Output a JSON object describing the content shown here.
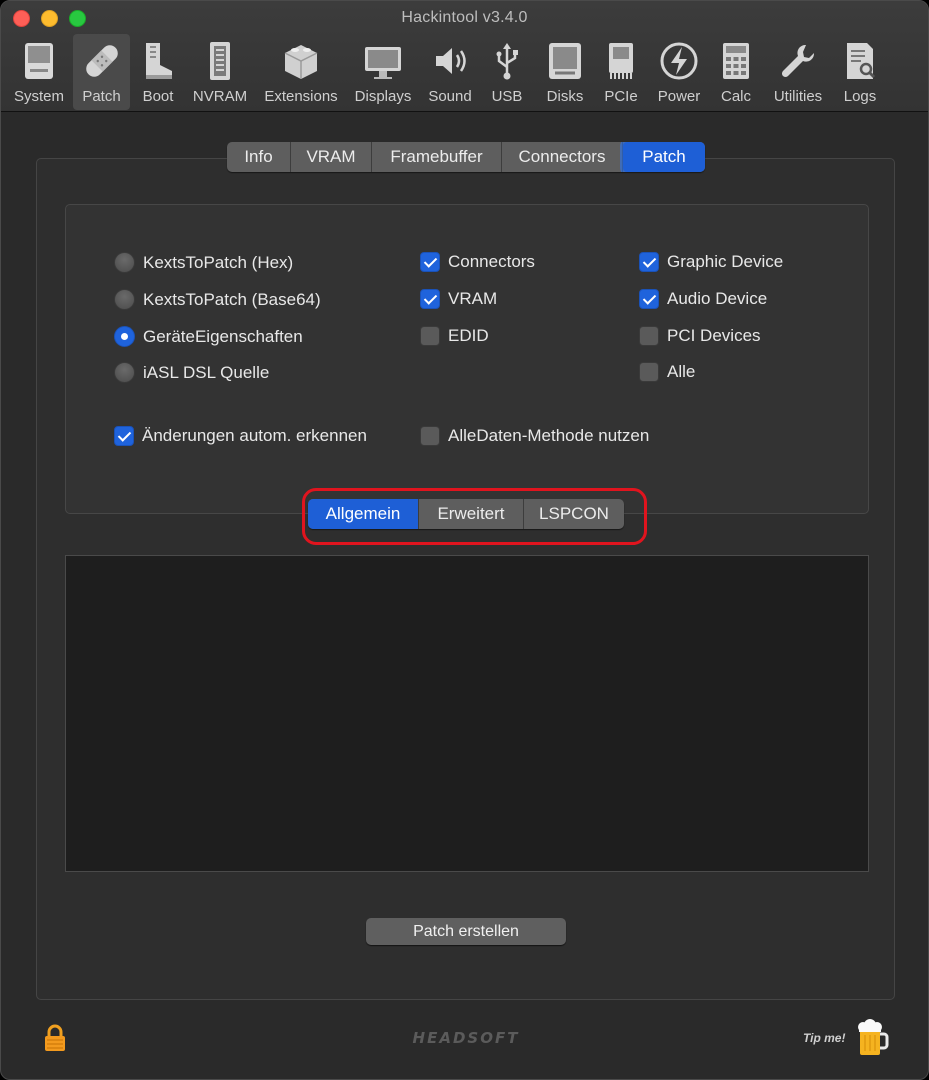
{
  "window": {
    "title": "Hackintool v3.4.0"
  },
  "toolbar": {
    "items": [
      {
        "label": "System",
        "icon": "system-icon"
      },
      {
        "label": "Patch",
        "icon": "bandage-icon",
        "active": true
      },
      {
        "label": "Boot",
        "icon": "boot-icon"
      },
      {
        "label": "NVRAM",
        "icon": "memory-icon"
      },
      {
        "label": "Extensions",
        "icon": "lego-icon"
      },
      {
        "label": "Displays",
        "icon": "display-icon"
      },
      {
        "label": "Sound",
        "icon": "speaker-icon"
      },
      {
        "label": "USB",
        "icon": "usb-icon"
      },
      {
        "label": "Disks",
        "icon": "disk-icon"
      },
      {
        "label": "PCIe",
        "icon": "pcie-icon"
      },
      {
        "label": "Power",
        "icon": "power-icon"
      },
      {
        "label": "Calc",
        "icon": "calculator-icon"
      },
      {
        "label": "Utilities",
        "icon": "wrench-icon"
      },
      {
        "label": "Logs",
        "icon": "logs-icon"
      }
    ]
  },
  "tabs": {
    "items": [
      "Info",
      "VRAM",
      "Framebuffer",
      "Connectors",
      "Patch"
    ],
    "selected": "Patch"
  },
  "options": {
    "radios": [
      {
        "label": "KextsToPatch (Hex)",
        "checked": false
      },
      {
        "label": "KextsToPatch (Base64)",
        "checked": false
      },
      {
        "label": "GeräteEigenschaften",
        "checked": true
      },
      {
        "label": "iASL DSL Quelle",
        "checked": false
      }
    ],
    "col2": [
      {
        "label": "Connectors",
        "checked": true
      },
      {
        "label": "VRAM",
        "checked": true
      },
      {
        "label": "EDID",
        "checked": false
      }
    ],
    "col3": [
      {
        "label": "Graphic Device",
        "checked": true
      },
      {
        "label": "Audio Device",
        "checked": true
      },
      {
        "label": "PCI Devices",
        "checked": false
      },
      {
        "label": "Alle",
        "checked": false
      }
    ],
    "autodetect": {
      "label": "Änderungen autom. erkennen",
      "checked": true
    },
    "alldata": {
      "label": "AlleDaten-Methode nutzen",
      "checked": false
    }
  },
  "subtabs": {
    "items": [
      "Allgemein",
      "Erweitert",
      "LSPCON"
    ],
    "selected": "Allgemein"
  },
  "output": {
    "text": ""
  },
  "actions": {
    "create_patch": "Patch erstellen"
  },
  "footer": {
    "brand": "HEADSOFT",
    "tip": "Tip me!"
  },
  "colors": {
    "accent": "#1e5fd6",
    "highlight": "#e0141e"
  }
}
